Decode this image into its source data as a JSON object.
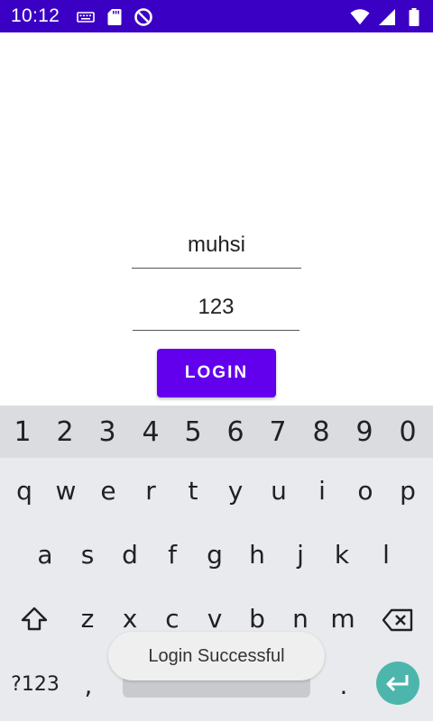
{
  "status_bar": {
    "time": "10:12",
    "left_icons": [
      "keyboard-icon",
      "sd-card-icon",
      "data-saver-icon"
    ],
    "right_icons": [
      "wifi-icon",
      "signal-icon",
      "battery-icon"
    ],
    "color": "#3a00c4"
  },
  "form": {
    "username_value": "muhsi",
    "password_value": "123",
    "login_label": "LOGIN",
    "accent": "#6200ee"
  },
  "keyboard": {
    "number_row": [
      "1",
      "2",
      "3",
      "4",
      "5",
      "6",
      "7",
      "8",
      "9",
      "0"
    ],
    "row1": [
      "q",
      "w",
      "e",
      "r",
      "t",
      "y",
      "u",
      "i",
      "o",
      "p"
    ],
    "row2": [
      "a",
      "s",
      "d",
      "f",
      "g",
      "h",
      "j",
      "k",
      "l"
    ],
    "row3": [
      "z",
      "x",
      "c",
      "v",
      "b",
      "n",
      "m"
    ],
    "symbols_label": "?123",
    "comma": ",",
    "period": ".",
    "enter_color": "#4db6ac"
  },
  "toast": {
    "message": "Login Successful"
  }
}
